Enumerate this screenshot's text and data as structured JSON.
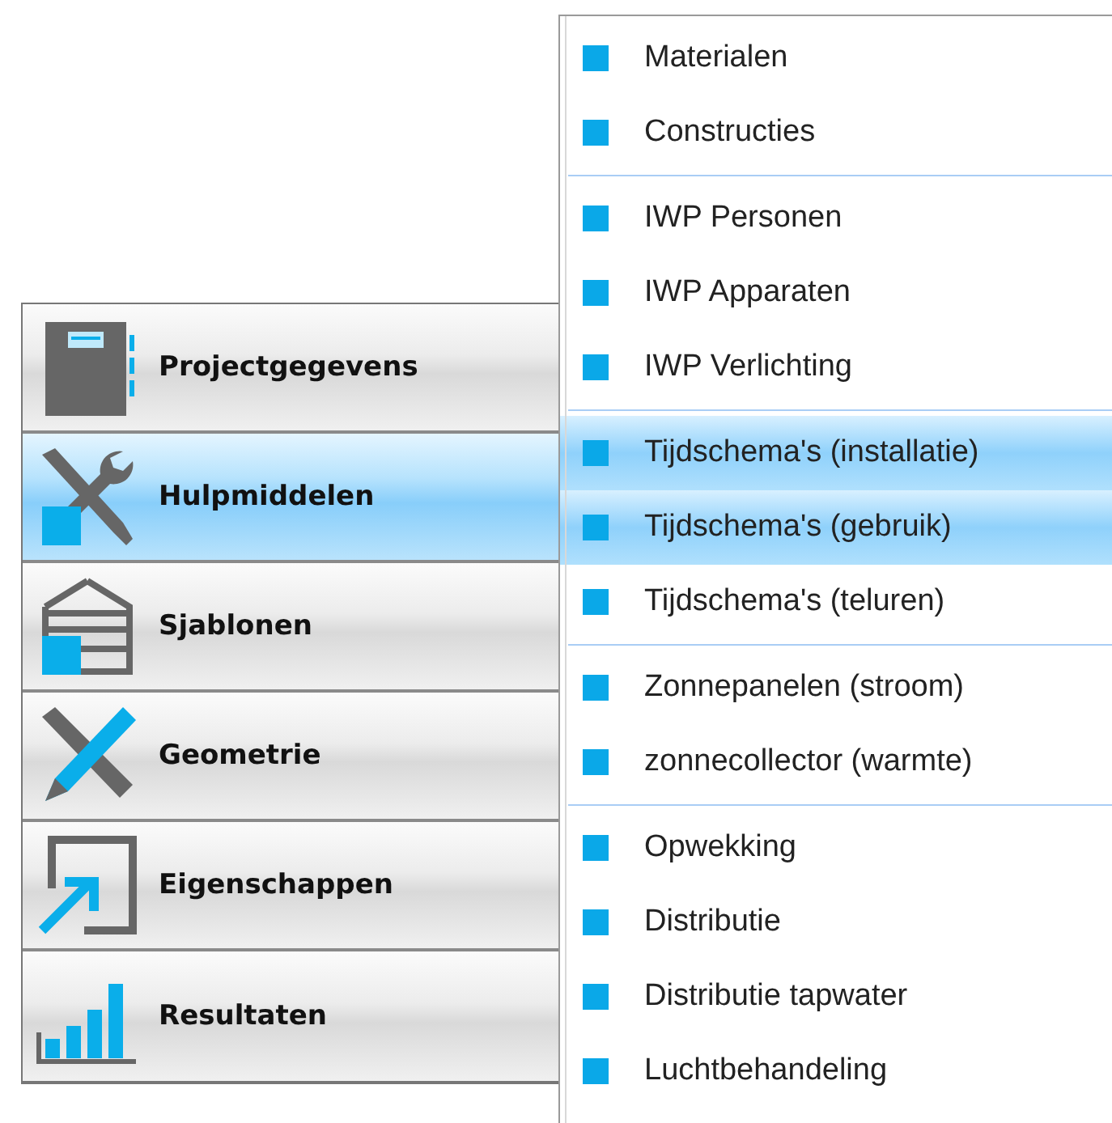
{
  "nav_buttons": [
    {
      "label": "Projectgegevens",
      "selected": false
    },
    {
      "label": "Hulpmiddelen",
      "selected": true
    },
    {
      "label": "Sjablonen",
      "selected": false
    },
    {
      "label": "Geometrie",
      "selected": false
    },
    {
      "label": "Eigenschappen",
      "selected": false
    },
    {
      "label": "Resultaten",
      "selected": false
    }
  ],
  "menu": {
    "groups": [
      [
        {
          "label": "Materialen",
          "highlighted": false
        },
        {
          "label": "Constructies",
          "highlighted": false
        }
      ],
      [
        {
          "label": "IWP Personen",
          "highlighted": false
        },
        {
          "label": "IWP Apparaten",
          "highlighted": false
        },
        {
          "label": "IWP Verlichting",
          "highlighted": false
        }
      ],
      [
        {
          "label": "Tijdschema's (installatie)",
          "highlighted": true
        },
        {
          "label": "Tijdschema's (gebruik)",
          "highlighted": true
        },
        {
          "label": "Tijdschema's (teluren)",
          "highlighted": false
        }
      ],
      [
        {
          "label": "Zonnepanelen (stroom)",
          "highlighted": false
        },
        {
          "label": "zonnecollector (warmte)",
          "highlighted": false
        }
      ],
      [
        {
          "label": "Opwekking",
          "highlighted": false
        },
        {
          "label": "Distributie",
          "highlighted": false
        },
        {
          "label": "Distributie tapwater",
          "highlighted": false
        },
        {
          "label": "Luchtbehandeling",
          "highlighted": false
        }
      ]
    ]
  }
}
